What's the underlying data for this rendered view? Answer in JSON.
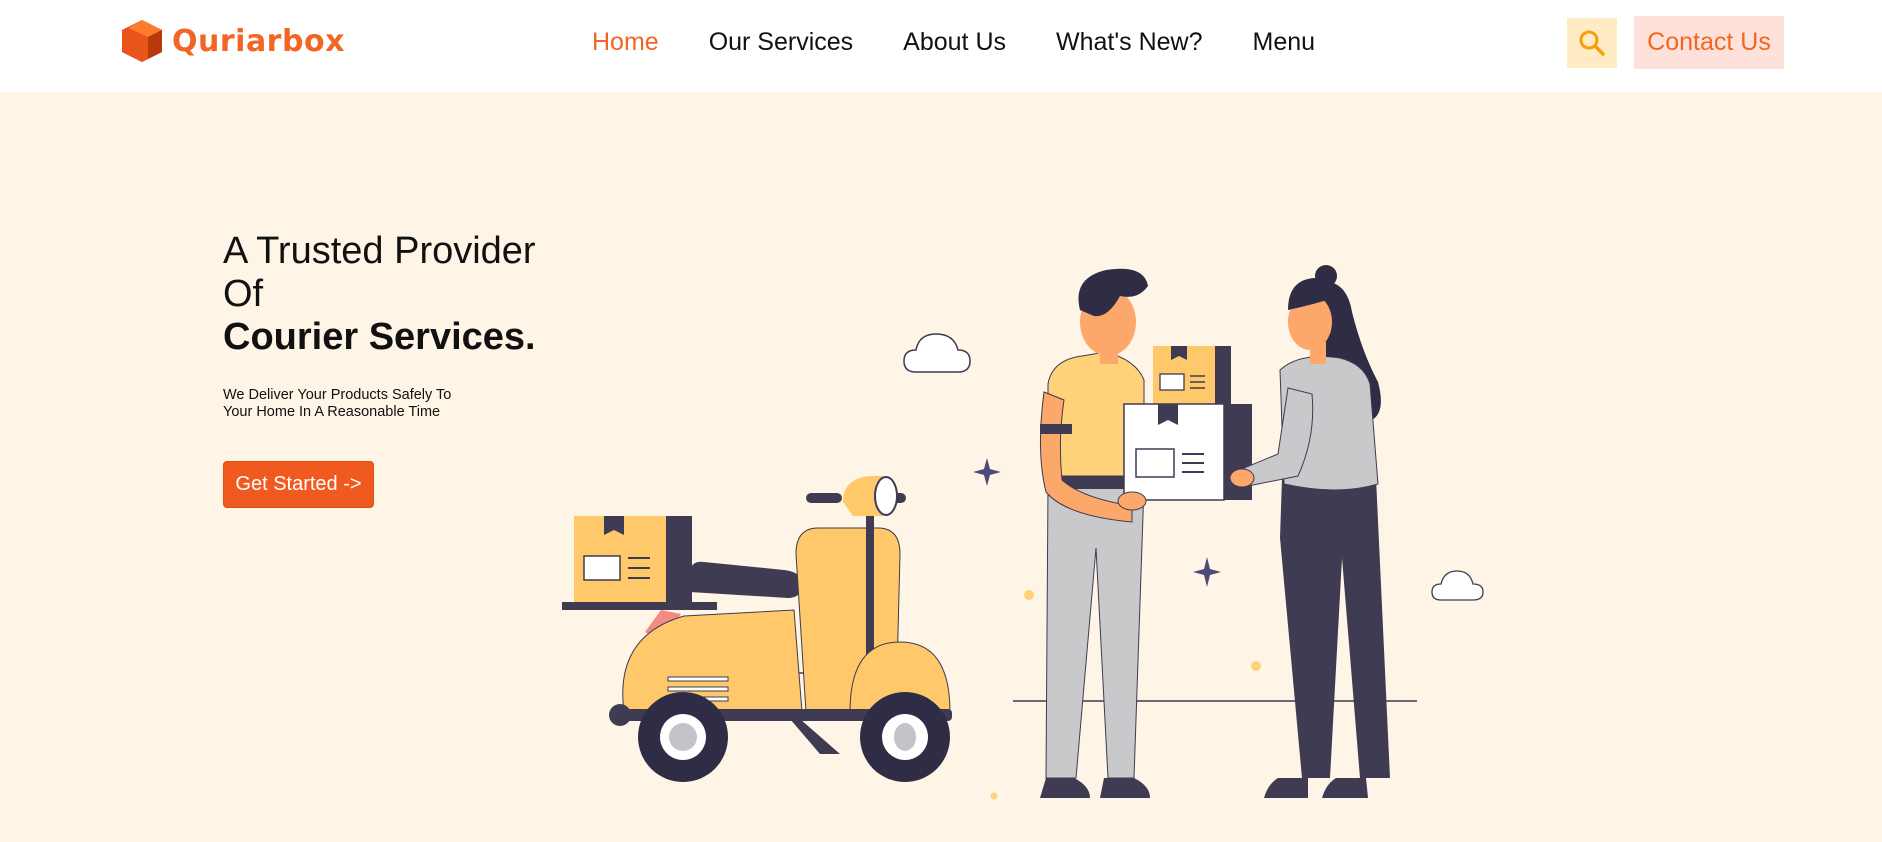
{
  "brand": {
    "name": "Quriarbox",
    "logo_icon": "hexagon-box-logo",
    "color": "#f26522"
  },
  "nav": {
    "items": [
      {
        "label": "Home",
        "active": true
      },
      {
        "label": "Our Services",
        "active": false
      },
      {
        "label": "About Us",
        "active": false
      },
      {
        "label": "What's New?",
        "active": false
      },
      {
        "label": "Menu",
        "active": false
      }
    ]
  },
  "header": {
    "search_icon": "search-icon",
    "contact_label": "Contact Us"
  },
  "hero": {
    "title_line1": "A Trusted Provider",
    "title_line2": "Of",
    "title_line3": "Courier Services.",
    "subtitle": "We Deliver Your Products Safely To Your Home In A Reasonable Time",
    "cta_label": "Get Started ->",
    "illustration": "delivery-scooter-couple-illustration"
  },
  "colors": {
    "accent": "#f26522",
    "hero_background": "#fff5e6",
    "search_background": "#ffecc4",
    "contact_background": "#fee1da"
  }
}
